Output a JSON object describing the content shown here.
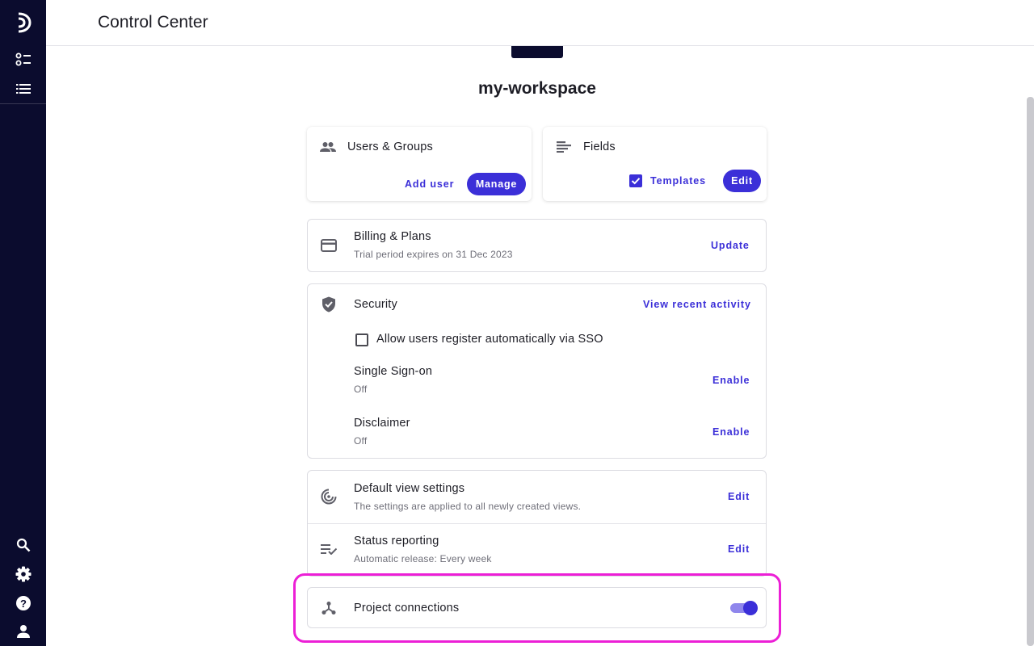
{
  "sidebar": {
    "top_icons": [
      "logo-icon",
      "checklist-icon",
      "list-icon"
    ],
    "bottom_icons": [
      "search-icon",
      "gear-icon",
      "help-icon",
      "user-icon"
    ]
  },
  "header": {
    "title": "Control Center"
  },
  "workspace": {
    "name": "my-workspace"
  },
  "users_groups": {
    "icon": "people-icon",
    "title": "Users & Groups",
    "add_user_label": "Add user",
    "manage_label": "Manage"
  },
  "fields": {
    "icon": "fields-icon",
    "title": "Fields",
    "templates_label": "Templates",
    "templates_checked": true,
    "edit_label": "Edit"
  },
  "billing": {
    "icon": "credit-card-icon",
    "title": "Billing & Plans",
    "subtitle": "Trial period expires on 31 Dec 2023",
    "action": "Update"
  },
  "security": {
    "icon": "shield-icon",
    "title": "Security",
    "action": "View recent activity",
    "sso_register_label": "Allow users register automatically via SSO",
    "sso_register_checked": false,
    "items": [
      {
        "title": "Single Sign-on",
        "status": "Off",
        "action": "Enable"
      },
      {
        "title": "Disclaimer",
        "status": "Off",
        "action": "Enable"
      }
    ]
  },
  "views": {
    "items": [
      {
        "icon": "radar-icon",
        "title": "Default view settings",
        "subtitle": "The settings are applied to all newly created views.",
        "action": "Edit"
      },
      {
        "icon": "status-check-icon",
        "title": "Status reporting",
        "subtitle": "Automatic release: Every week",
        "action": "Edit"
      }
    ]
  },
  "project_connections": {
    "icon": "connections-icon",
    "title": "Project connections",
    "enabled": true
  },
  "colors": {
    "sidebar": "#0b0c2e",
    "accent": "#3b2fd8",
    "highlight": "#ec1fd6"
  }
}
